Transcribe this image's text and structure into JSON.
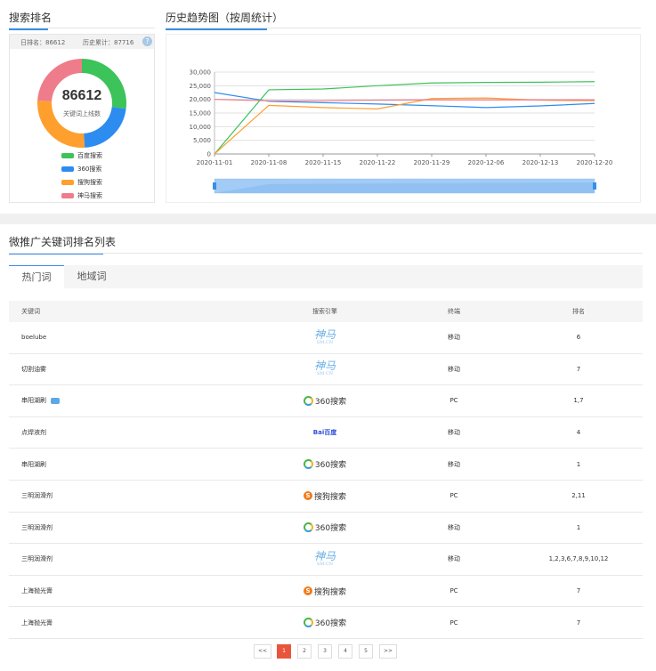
{
  "rank_section": {
    "title": "搜索排名",
    "today_label": "日排名：",
    "today_value": "86612",
    "history_label": "历史累计：",
    "history_value": "87716",
    "help": "?",
    "donut_number": "86612",
    "donut_caption": "关键词上线数",
    "donut_segments": [
      {
        "name": "百度搜索",
        "value": 0.27,
        "color": "#3cc35a"
      },
      {
        "name": "360搜索",
        "value": 0.22,
        "color": "#2d8cf0"
      },
      {
        "name": "搜狗搜索",
        "value": 0.27,
        "color": "#ff9f2e"
      },
      {
        "name": "神马搜索",
        "value": 0.24,
        "color": "#ee7c8a"
      }
    ]
  },
  "trend_section": {
    "title": "历史趋势图（按周统计）"
  },
  "chart_data": {
    "type": "line",
    "categories": [
      "2020-11-01",
      "2020-11-08",
      "2020-11-15",
      "2020-11-22",
      "2020-11-29",
      "2020-12-06",
      "2020-12-13",
      "2020-12-20"
    ],
    "ylim": [
      0,
      30000
    ],
    "yticks": [
      "0",
      "5,000",
      "10,000",
      "15,000",
      "20,000",
      "25,000",
      "30,000"
    ],
    "grid": true,
    "series": [
      {
        "values": [
          0,
          23500,
          23800,
          25000,
          26000,
          26200,
          26300,
          26500
        ],
        "color": "#3cc35a"
      },
      {
        "values": [
          22500,
          19300,
          18800,
          18300,
          17700,
          17000,
          17600,
          18500
        ],
        "color": "#2d8cf0"
      },
      {
        "values": [
          0,
          17800,
          17000,
          16500,
          20300,
          20500,
          19700,
          19500
        ],
        "color": "#ff9f2e"
      },
      {
        "values": [
          20000,
          19500,
          19500,
          19700,
          19800,
          19800,
          19800,
          19800
        ],
        "color": "#ee7c8a"
      }
    ]
  },
  "list_section": {
    "title": "微推广关键词排名列表",
    "tabs": [
      "热门词",
      "地域词"
    ],
    "columns": [
      "关键词",
      "搜索引擎",
      "终端",
      "排名"
    ],
    "rows": [
      {
        "keyword": "boelube",
        "engine": "神马",
        "terminal": "移动",
        "rank": "6"
      },
      {
        "keyword": "切割油雾",
        "engine": "神马",
        "terminal": "移动",
        "rank": "7"
      },
      {
        "keyword": "串阳湖刷",
        "engine": "360搜索",
        "terminal": "PC",
        "rank": "1,7"
      },
      {
        "keyword": "点焊液剂",
        "engine": "Bai百度",
        "terminal": "移动",
        "rank": "4"
      },
      {
        "keyword": "串阳湖刷",
        "engine": "360搜索",
        "terminal": "移动",
        "rank": "1"
      },
      {
        "keyword": "三明润滑剂",
        "engine": "搜狗搜索",
        "terminal": "PC",
        "rank": "2,11"
      },
      {
        "keyword": "三明润滑剂",
        "engine": "360搜索",
        "terminal": "移动",
        "rank": "1"
      },
      {
        "keyword": "三明润滑剂",
        "engine": "神马",
        "terminal": "移动",
        "rank": "1,2,3,6,7,8,9,10,12"
      },
      {
        "keyword": "上海抛光膏",
        "engine": "搜狗搜索",
        "terminal": "PC",
        "rank": "7"
      },
      {
        "keyword": "上海抛光膏",
        "engine": "360搜索",
        "terminal": "PC",
        "rank": "7"
      }
    ],
    "shenma_sub": "SM.CN",
    "pagination": [
      "<<",
      "1",
      "2",
      "3",
      "4",
      "5",
      ">>"
    ],
    "current_page": "1"
  }
}
